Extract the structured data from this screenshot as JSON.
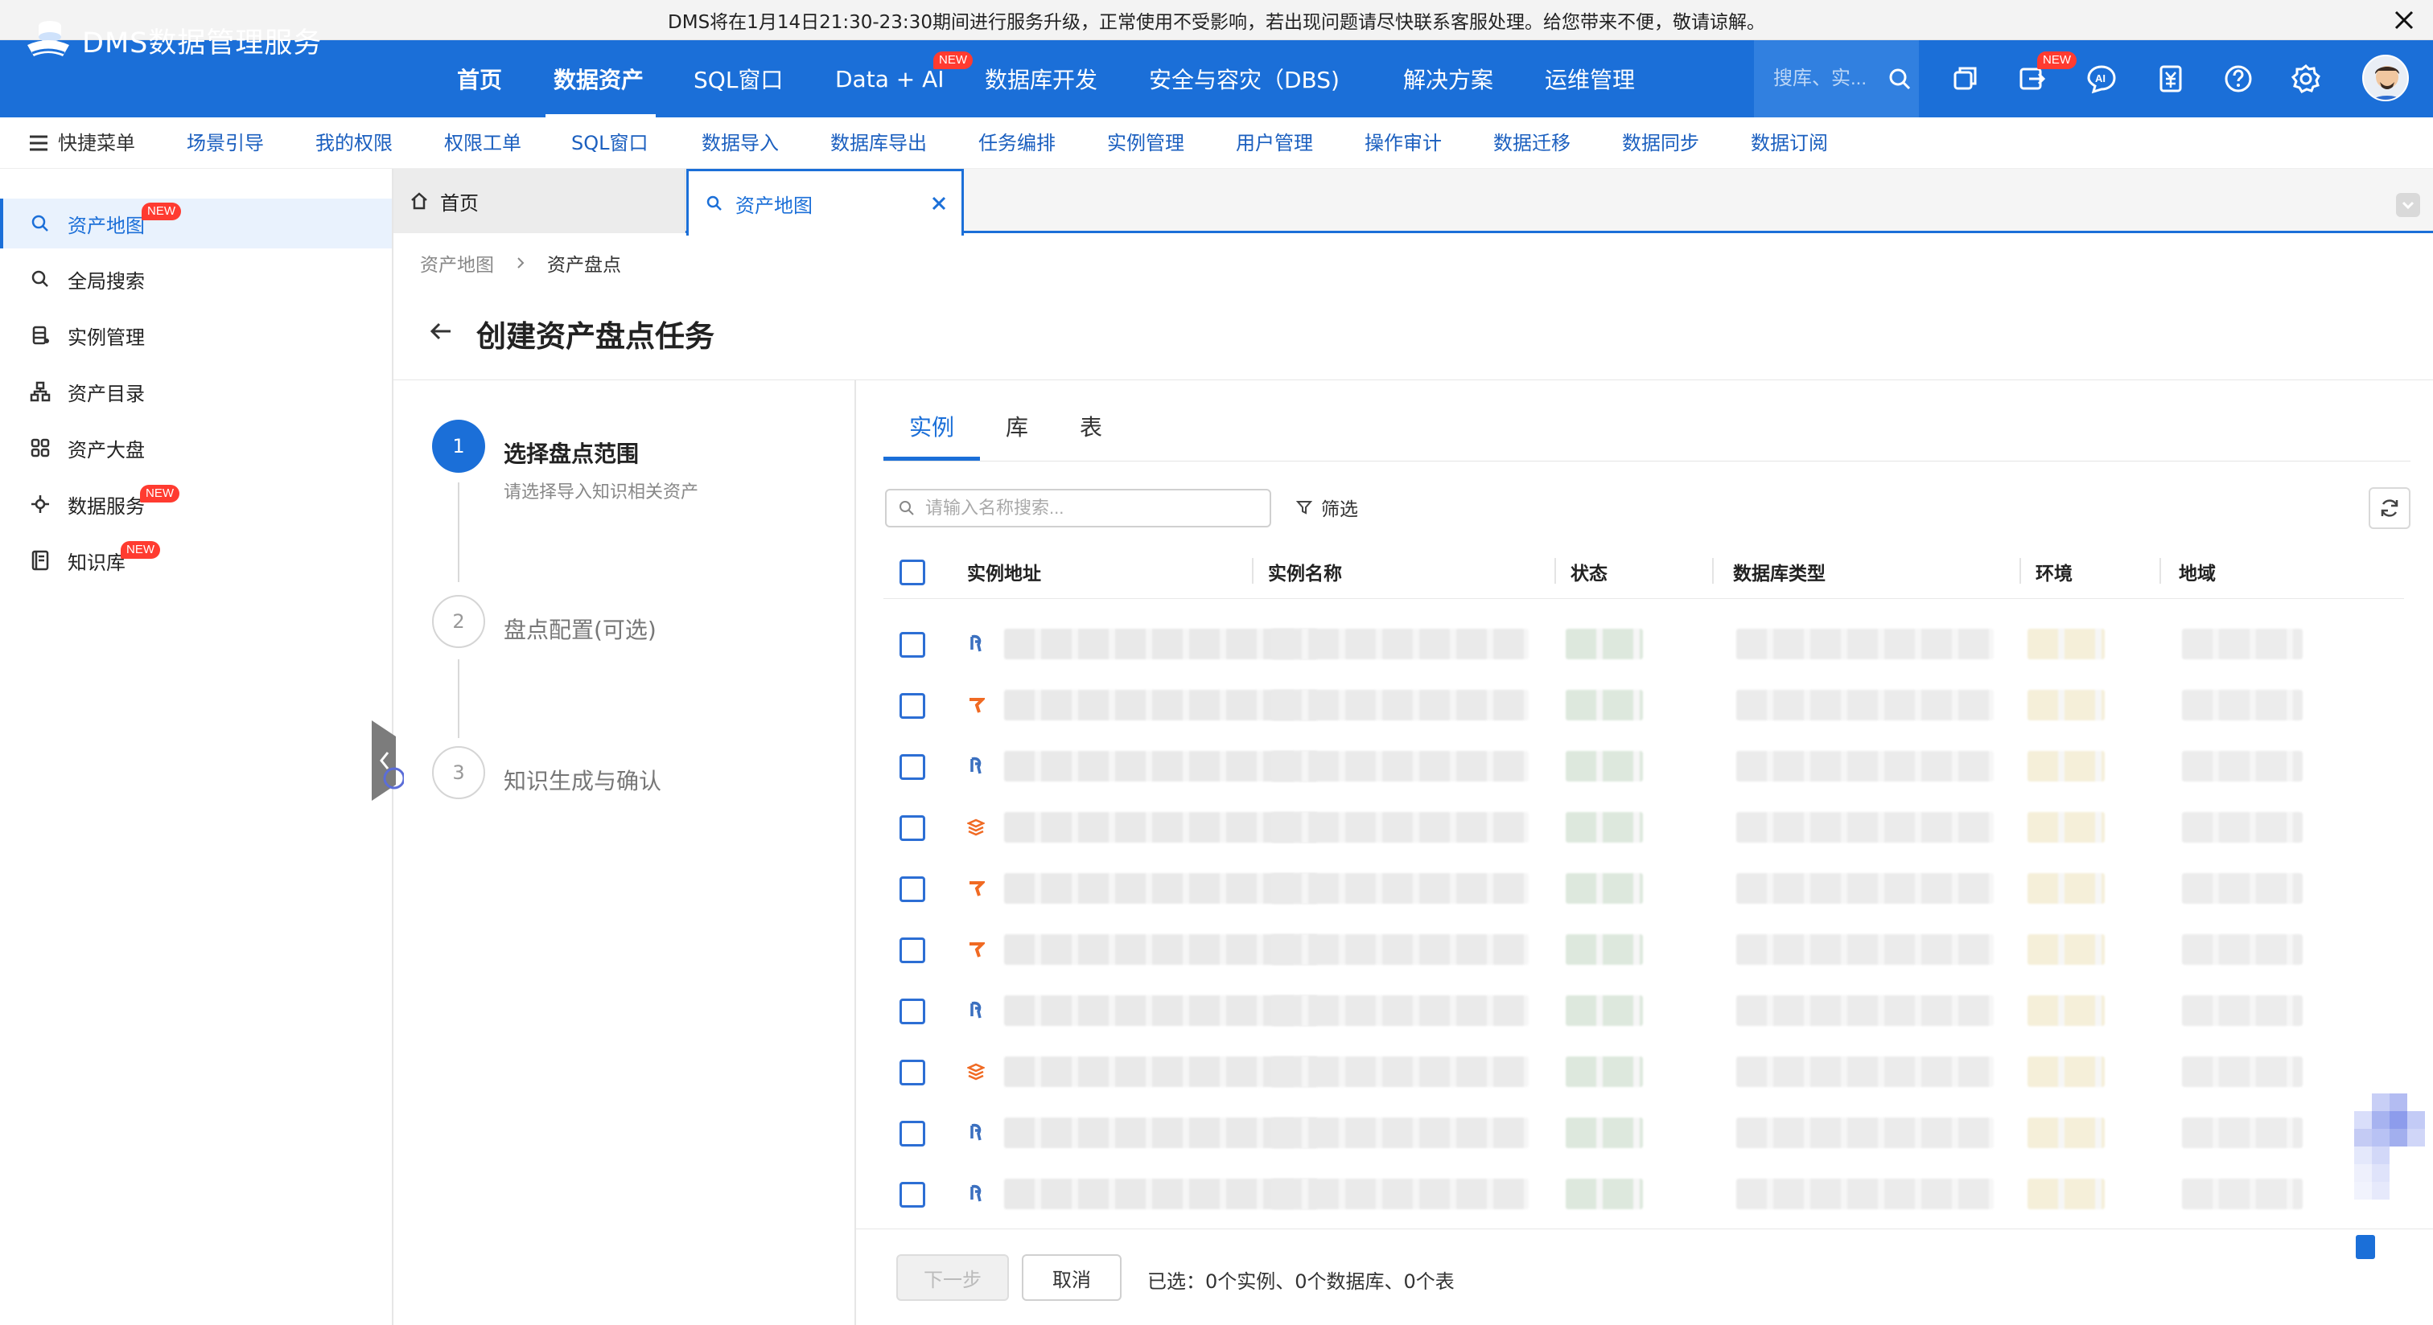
{
  "announcement": {
    "text": "DMS将在1月14日21:30-23:30期间进行服务升级，正常使用不受影响，若出现问题请尽快联系客服处理。给您带来不便，敬请谅解。"
  },
  "header": {
    "logo_text": "DMS数据管理服务",
    "nav": [
      {
        "label": "首页"
      },
      {
        "label": "数据资产"
      },
      {
        "label": "SQL窗口"
      },
      {
        "label": "Data + AI",
        "badge": "NEW"
      },
      {
        "label": "数据库开发"
      },
      {
        "label": "安全与容灾（DBS)"
      },
      {
        "label": "解决方案"
      },
      {
        "label": "运维管理"
      }
    ],
    "search_placeholder": "搜库、实...",
    "badge_new": "NEW"
  },
  "quickbar": {
    "menu_label": "快捷菜单",
    "items": [
      "场景引导",
      "我的权限",
      "权限工单",
      "SQL窗口",
      "数据导入",
      "数据库导出",
      "任务编排",
      "实例管理",
      "用户管理",
      "操作审计",
      "数据迁移",
      "数据同步",
      "数据订阅"
    ]
  },
  "sidebar": {
    "items": [
      {
        "label": "资产地图",
        "badge": "NEW",
        "icon": "search-icon"
      },
      {
        "label": "全局搜索",
        "icon": "search-icon"
      },
      {
        "label": "实例管理",
        "icon": "database-icon"
      },
      {
        "label": "资产目录",
        "icon": "tree-icon"
      },
      {
        "label": "资产大盘",
        "icon": "grid-icon"
      },
      {
        "label": "数据服务",
        "badge": "NEW",
        "icon": "plug-icon"
      },
      {
        "label": "知识库",
        "badge": "NEW",
        "icon": "book-icon"
      }
    ]
  },
  "tabs": {
    "home": "首页",
    "asset_map": "资产地图"
  },
  "breadcrumb": {
    "parent": "资产地图",
    "current": "资产盘点"
  },
  "page": {
    "title": "创建资产盘点任务"
  },
  "steps": [
    {
      "number": "1",
      "title": "选择盘点范围",
      "desc": "请选择导入知识相关资产"
    },
    {
      "number": "2",
      "title": "盘点配置(可选)"
    },
    {
      "number": "3",
      "title": "知识生成与确认"
    }
  ],
  "main_tabs": [
    "实例",
    "库",
    "表"
  ],
  "search": {
    "placeholder": "请输入名称搜索..."
  },
  "filter_label": "筛选",
  "table": {
    "columns": [
      "实例地址",
      "实例名称",
      "状态",
      "数据库类型",
      "环境",
      "地域"
    ],
    "rows": [
      {
        "db_icon": "db-blue"
      },
      {
        "db_icon": "db-orange"
      },
      {
        "db_icon": "db-blue"
      },
      {
        "db_icon": "db-stack"
      },
      {
        "db_icon": "db-orange"
      },
      {
        "db_icon": "db-orange"
      },
      {
        "db_icon": "db-blue"
      },
      {
        "db_icon": "db-stack"
      },
      {
        "db_icon": "db-blue"
      },
      {
        "db_icon": "db-blue"
      }
    ]
  },
  "footer": {
    "next_label": "下一步",
    "cancel_label": "取消",
    "summary": "已选：0个实例、0个数据库、0个表"
  },
  "colors": {
    "brand": "#1b6fd8",
    "badge": "#ff3b30",
    "db_blue": "#3a6fbf",
    "db_orange": "#f06a23"
  }
}
